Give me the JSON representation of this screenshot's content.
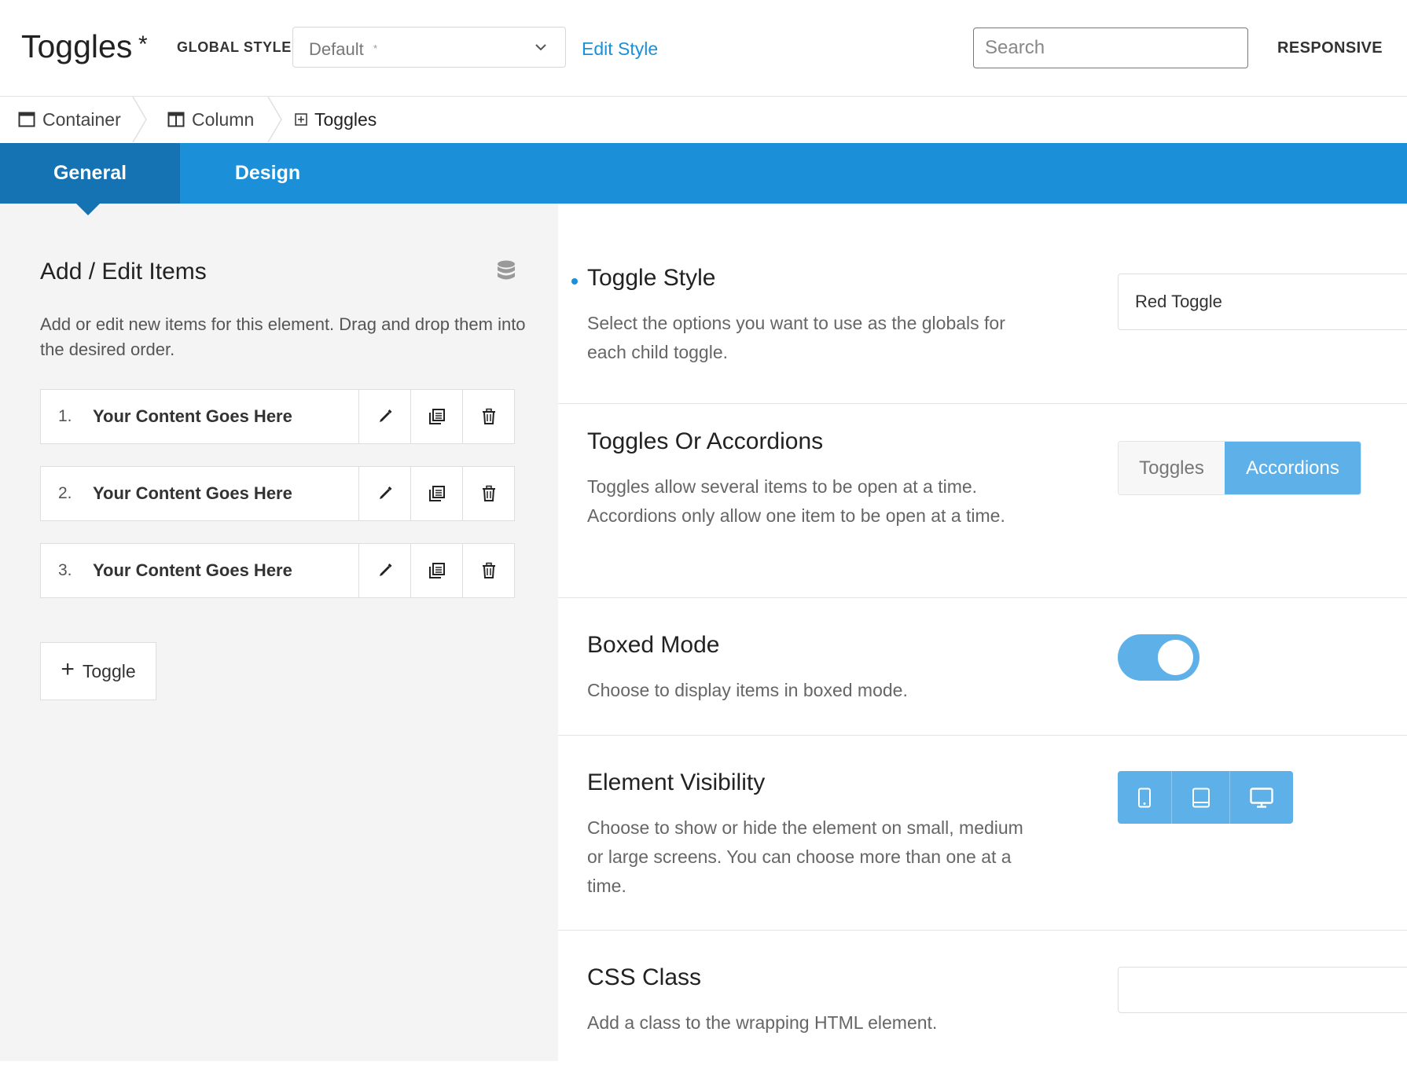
{
  "header": {
    "title": "Toggles",
    "title_modified_marker": "*",
    "global_style_label": "GLOBAL STYLE",
    "global_style_value": "Default",
    "global_style_marker": "*",
    "edit_style_label": "Edit Style",
    "search_placeholder": "Search",
    "responsive_label": "RESPONSIVE"
  },
  "breadcrumb": {
    "items": [
      {
        "label": "Container",
        "icon": "container-icon"
      },
      {
        "label": "Column",
        "icon": "column-icon"
      },
      {
        "label": "Toggles",
        "icon": "toggles-plus-icon"
      }
    ]
  },
  "tabs": [
    {
      "label": "General",
      "active": true
    },
    {
      "label": "Design",
      "active": false
    }
  ],
  "left": {
    "heading": "Add / Edit Items",
    "description": "Add or edit new items for this element. Drag and drop them into the desired order.",
    "items": [
      {
        "num": "1.",
        "label": "Your Content Goes Here"
      },
      {
        "num": "2.",
        "label": "Your Content Goes Here"
      },
      {
        "num": "3.",
        "label": "Your Content Goes Here"
      }
    ],
    "add_button_label": "Toggle",
    "add_button_symbol": "+"
  },
  "settings": {
    "toggle_style": {
      "title": "Toggle Style",
      "description": "Select the options you want to use as the globals for each child toggle.",
      "value": "Red Toggle"
    },
    "toggles_or_accordions": {
      "title": "Toggles Or Accordions",
      "description": "Toggles allow several items to be open at a time. Accordions only allow one item to be open at a time.",
      "options": [
        "Toggles",
        "Accordions"
      ],
      "selected": "Accordions"
    },
    "boxed_mode": {
      "title": "Boxed Mode",
      "description": "Choose to display items in boxed mode.",
      "enabled": true
    },
    "element_visibility": {
      "title": "Element Visibility",
      "description": "Choose to show or hide the element on small, medium or large screens. You can choose more than one at a time.",
      "options": [
        "small-screen-icon",
        "medium-screen-icon",
        "large-screen-icon"
      ],
      "all_selected": true
    },
    "css_class": {
      "title": "CSS Class",
      "description": "Add a class to the wrapping HTML element.",
      "value": ""
    }
  },
  "colors": {
    "accent": "#1b8fd8",
    "accent_dark": "#1573b3",
    "accent_light": "#5db0e8",
    "left_panel_bg": "#f4f4f4"
  }
}
